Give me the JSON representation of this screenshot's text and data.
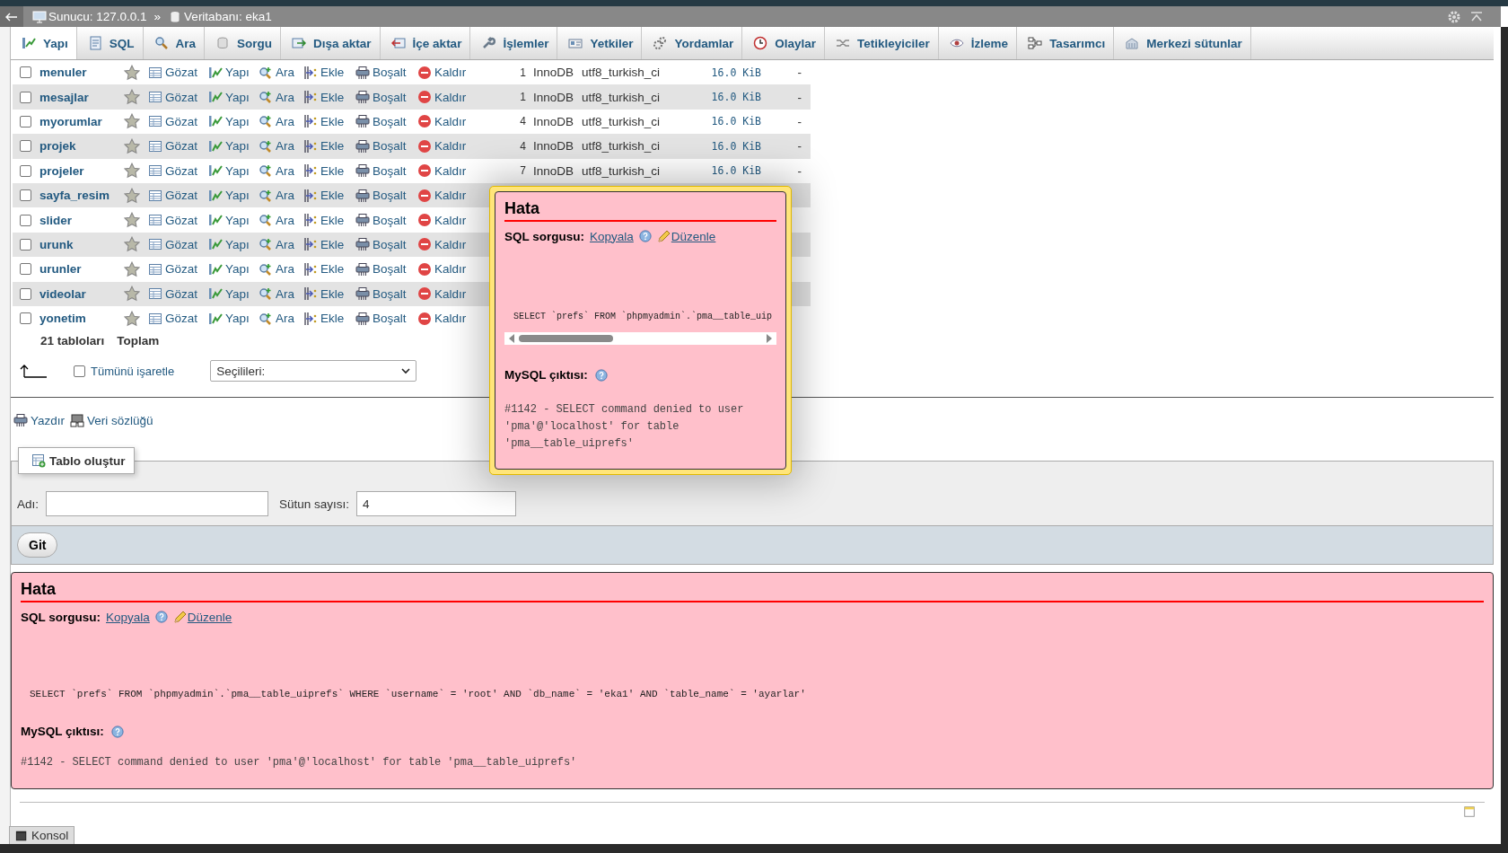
{
  "breadcrumb": {
    "server": "Sunucu: 127.0.0.1",
    "separator": "»",
    "database": "Veritabanı: eka1"
  },
  "tabs": [
    {
      "label": "Yapı",
      "selected": true
    },
    {
      "label": "SQL",
      "selected": false
    },
    {
      "label": "Ara",
      "selected": false
    },
    {
      "label": "Sorgu",
      "selected": false
    },
    {
      "label": "Dışa aktar",
      "selected": false
    },
    {
      "label": "İçe aktar",
      "selected": false
    },
    {
      "label": "İşlemler",
      "selected": false
    },
    {
      "label": "Yetkiler",
      "selected": false
    },
    {
      "label": "Yordamlar",
      "selected": false
    },
    {
      "label": "Olaylar",
      "selected": false
    },
    {
      "label": "Tetikleyiciler",
      "selected": false
    },
    {
      "label": "İzleme",
      "selected": false
    },
    {
      "label": "Tasarımcı",
      "selected": false
    },
    {
      "label": "Merkezi sütunlar",
      "selected": false
    }
  ],
  "tables": [
    {
      "name": "menuler",
      "checked": false,
      "actions": [
        "Gözat",
        "Yapı",
        "Ara",
        "Ekle",
        "Boşalt",
        "Kaldır"
      ],
      "rows": "1",
      "engine": "InnoDB",
      "collation": "utf8_turkish_ci",
      "size": "16.0 KiB",
      "overhead": "-"
    },
    {
      "name": "mesajlar",
      "checked": false,
      "actions": [
        "Gözat",
        "Yapı",
        "Ara",
        "Ekle",
        "Boşalt",
        "Kaldır"
      ],
      "rows": "1",
      "engine": "InnoDB",
      "collation": "utf8_turkish_ci",
      "size": "16.0 KiB",
      "overhead": "-"
    },
    {
      "name": "myorumlar",
      "checked": false,
      "actions": [
        "Gözat",
        "Yapı",
        "Ara",
        "Ekle",
        "Boşalt",
        "Kaldır"
      ],
      "rows": "4",
      "engine": "InnoDB",
      "collation": "utf8_turkish_ci",
      "size": "16.0 KiB",
      "overhead": "-"
    },
    {
      "name": "projek",
      "checked": false,
      "actions": [
        "Gözat",
        "Yapı",
        "Ara",
        "Ekle",
        "Boşalt",
        "Kaldır"
      ],
      "rows": "4",
      "engine": "InnoDB",
      "collation": "utf8_turkish_ci",
      "size": "16.0 KiB",
      "overhead": "-"
    },
    {
      "name": "projeler",
      "checked": false,
      "actions": [
        "Gözat",
        "Yapı",
        "Ara",
        "Ekle",
        "Boşalt",
        "Kaldır"
      ],
      "rows": "7",
      "engine": "InnoDB",
      "collation": "utf8_turkish_ci",
      "size": "16.0 KiB",
      "overhead": "-"
    },
    {
      "name": "sayfa_resim",
      "checked": false,
      "actions": [
        "Gözat",
        "Yapı",
        "Ara",
        "Ekle",
        "Boşalt",
        "Kaldır"
      ]
    },
    {
      "name": "slider",
      "checked": false,
      "actions": [
        "Gözat",
        "Yapı",
        "Ara",
        "Ekle",
        "Boşalt",
        "Kaldır"
      ]
    },
    {
      "name": "urunk",
      "checked": false,
      "actions": [
        "Gözat",
        "Yapı",
        "Ara",
        "Ekle",
        "Boşalt",
        "Kaldır"
      ]
    },
    {
      "name": "urunler",
      "checked": false,
      "actions": [
        "Gözat",
        "Yapı",
        "Ara",
        "Ekle",
        "Boşalt",
        "Kaldır"
      ]
    },
    {
      "name": "videolar",
      "checked": false,
      "actions": [
        "Gözat",
        "Yapı",
        "Ara",
        "Ekle",
        "Boşalt",
        "Kaldır"
      ]
    },
    {
      "name": "yonetim",
      "checked": false,
      "actions": [
        "Gözat",
        "Yapı",
        "Ara",
        "Ekle",
        "Boşalt",
        "Kaldır"
      ]
    }
  ],
  "summary": {
    "count": "21 tabloları",
    "label": "Toplam"
  },
  "bulk": {
    "check_all": "Tümünü işaretle",
    "checked": false,
    "select": "Seçilileri:"
  },
  "links": [
    "Yazdır",
    "Veri sözlüğü"
  ],
  "create_table": {
    "legend": "Tablo oluştur",
    "name_label": "Adı:",
    "columns_label": "Sütun sayısı:",
    "columns_value": "4",
    "button": "Git"
  },
  "errors": [
    {
      "title": "Hata",
      "query_label": "SQL sorgusu:",
      "copy": "Kopyala",
      "edit": "Düzenle",
      "query": "SELECT `prefs` FROM `phpmyadmin`.`pma__table_uip",
      "output_label": "MySQL çıktısı:",
      "message": "#1142 - SELECT command denied to user 'pma'@'localhost' for table 'pma__table_uiprefs'"
    },
    {
      "title": "Hata",
      "query_label": "SQL sorgusu:",
      "copy": "Kopyala",
      "edit": "Düzenle",
      "query": "SELECT `prefs` FROM `phpmyadmin`.`pma__table_uiprefs` WHERE `username` = 'root' AND `db_name` = 'eka1' AND `table_name` = 'ayarlar'",
      "output_label": "MySQL çıktısı:",
      "message": "#1142 - SELECT command denied to user 'pma'@'localhost' for table 'pma__table_uiprefs'"
    }
  ],
  "console": "Konsol"
}
